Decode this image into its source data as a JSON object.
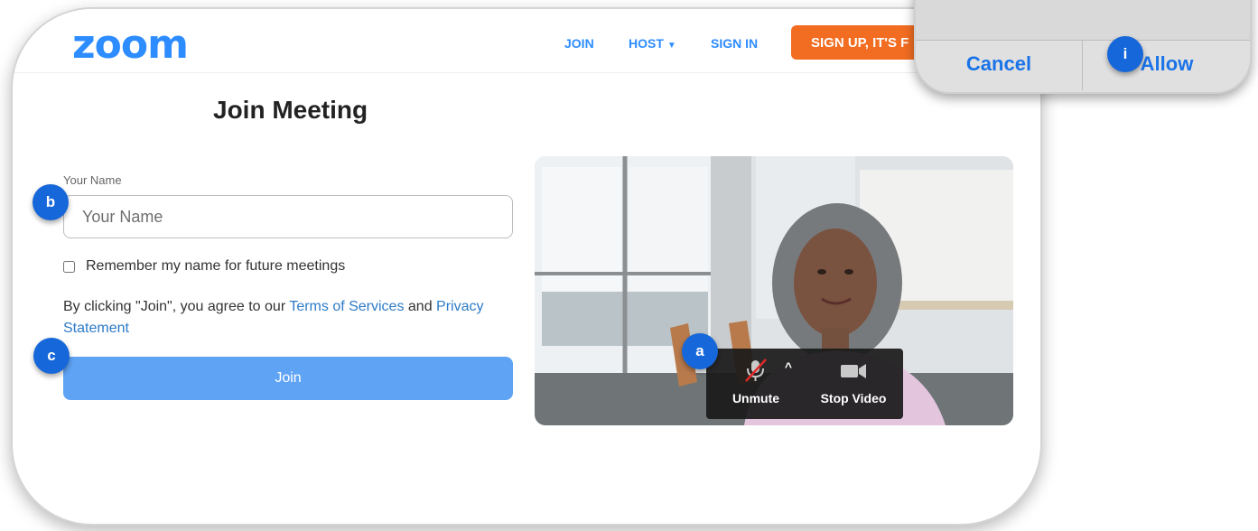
{
  "nav": {
    "logo": "zoom",
    "join": "JOIN",
    "host": "HOST",
    "sign_in": "SIGN IN",
    "signup": "SIGN UP, IT'S F"
  },
  "main": {
    "title": "Join Meeting",
    "name_label": "Your Name",
    "name_placeholder": "Your Name",
    "remember_label": "Remember my name for future meetings",
    "terms_prefix": "By clicking \"Join\", you agree to our ",
    "terms_link": "Terms of Services",
    "terms_and": " and ",
    "privacy_link": "Privacy Statement",
    "join_button": "Join"
  },
  "preview": {
    "unmute": "Unmute",
    "caret": "^",
    "stop_video": "Stop Video"
  },
  "badges": {
    "a": "a",
    "b": "b",
    "c": "c",
    "i": "i"
  },
  "dialog": {
    "cancel": "Cancel",
    "allow": "Allow"
  },
  "colors": {
    "brand": "#2d8cff",
    "signup": "#f26d21",
    "join_button": "#5fa3f5",
    "badge": "#1667d9"
  }
}
